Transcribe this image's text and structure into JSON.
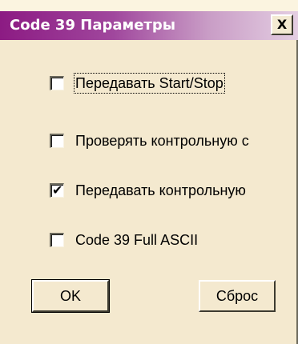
{
  "window": {
    "title": "Code 39 Параметры",
    "close_glyph": "X"
  },
  "options": [
    {
      "label": "Передавать Start/Stop",
      "checked": false,
      "focused": true
    },
    {
      "label": "Проверять контрольную с",
      "checked": false,
      "focused": false
    },
    {
      "label": "Передавать контрольную",
      "checked": true,
      "focused": false
    },
    {
      "label": "Code 39 Full ASCII",
      "checked": false,
      "focused": false
    }
  ],
  "buttons": {
    "ok_label": "OK",
    "reset_label": "Сброс"
  },
  "checkmark_glyph": "✔",
  "colors": {
    "title_start": "#8c1b83",
    "title_end": "#e4cee2",
    "dialog_face": "#f4e9cf"
  }
}
